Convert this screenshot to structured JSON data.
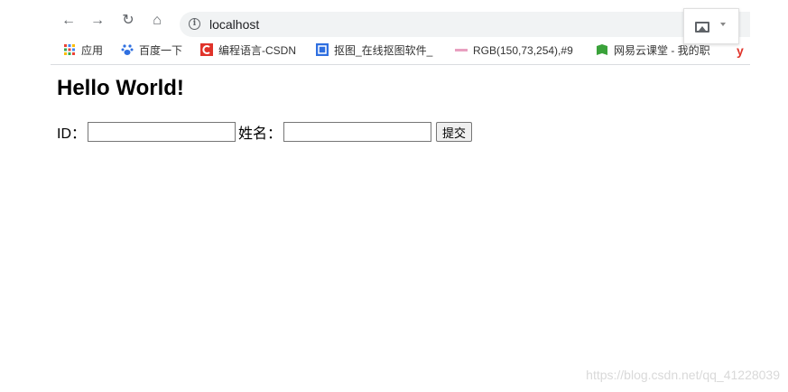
{
  "browser": {
    "url": "localhost",
    "bookmarks": [
      {
        "label": "应用",
        "icon": "apps-grid-icon"
      },
      {
        "label": "百度一下",
        "icon": "baidu-paw-icon"
      },
      {
        "label": "编程语言-CSDN",
        "icon": "csdn-c-icon"
      },
      {
        "label": "抠图_在线抠图软件_",
        "icon": "koutu-icon"
      },
      {
        "label": "RGB(150,73,254),#9",
        "icon": "rgb-site-icon"
      },
      {
        "label": "网易云课堂 - 我的职",
        "icon": "netease-book-icon"
      }
    ],
    "colors": {
      "csdn": "#e0332a",
      "koutu": "#2f6fe0",
      "netease": "#3aa23a",
      "trailing": "#e0332a"
    }
  },
  "page": {
    "title": "Hello World!",
    "form": {
      "id_label": "ID：",
      "id_value": "",
      "name_label": "姓名：",
      "name_value": "",
      "submit_label": "提交"
    }
  },
  "watermark": "https://blog.csdn.net/qq_41228039"
}
